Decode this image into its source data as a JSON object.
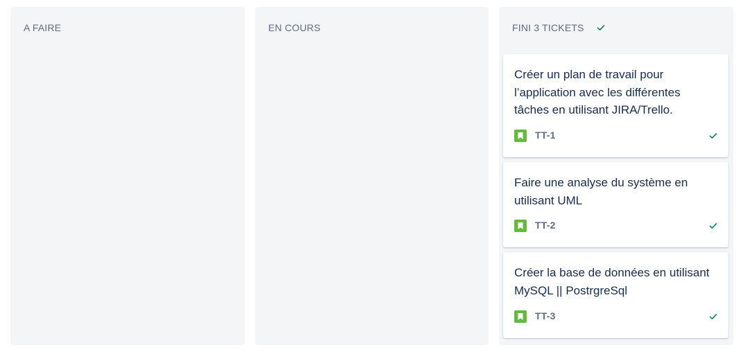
{
  "columns": {
    "todo": {
      "title": "A FAIRE"
    },
    "in_progress": {
      "title": "EN COURS"
    },
    "done": {
      "title": "FINI 3 TICKETS"
    }
  },
  "cards": [
    {
      "title": "Créer un plan de travail pour l’application avec les différentes tâches en utilisant JIRA/Trello.",
      "key": "TT-1",
      "type_icon": "story-icon",
      "status_icon": "check-icon"
    },
    {
      "title": "Faire une analyse du système en utilisant UML",
      "key": "TT-2",
      "type_icon": "story-icon",
      "status_icon": "check-icon"
    },
    {
      "title": "Créer la base de données en utilisant MySQL || PostrgreSql",
      "key": "TT-3",
      "type_icon": "story-icon",
      "status_icon": "check-icon"
    }
  ],
  "colors": {
    "column_bg": "#f4f5f7",
    "header_text": "#5e6c84",
    "card_text": "#172b4d",
    "story_green": "#63ba3c",
    "check_green": "#00875a"
  }
}
